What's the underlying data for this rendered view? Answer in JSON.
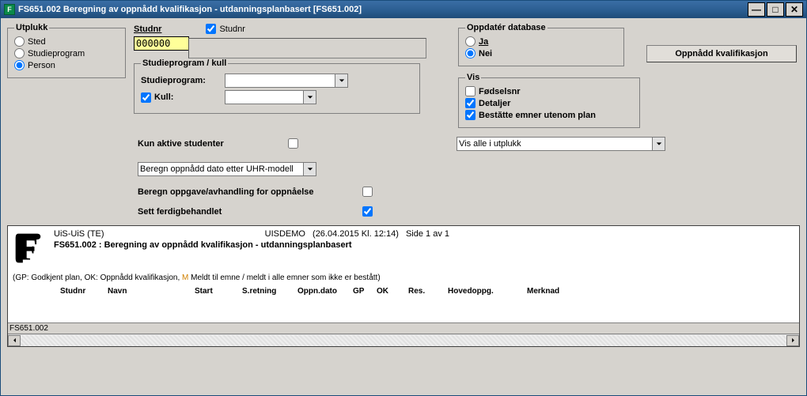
{
  "titlebar": {
    "icon_letter": "F",
    "title": "FS651.002 Beregning av oppnådd kvalifikasjon - utdanningsplanbasert [FS651.002]"
  },
  "utplukk": {
    "legend": "Utplukk",
    "options": {
      "sted": "Sted",
      "studieprogram": "Studieprogram",
      "person": "Person"
    },
    "selected": "person"
  },
  "studnr": {
    "label": "Studnr",
    "check_label": "Studnr",
    "value": "000000"
  },
  "sp_kull": {
    "legend": "Studieprogram / kull",
    "sp_label": "Studieprogram:",
    "kull_label": "Kull:",
    "sp_value": "",
    "kull_value": ""
  },
  "oppdater": {
    "legend": "Oppdatér database",
    "ja": "Ja",
    "nei": "Nei",
    "selected": "nei"
  },
  "vis": {
    "legend": "Vis",
    "fodselsnr": "Fødselsnr",
    "detaljer": "Detaljer",
    "bestatte": "Bestătte emner utenom plan",
    "fodselsnr_checked": false,
    "detaljer_checked": true,
    "bestatte_checked": true
  },
  "button": {
    "oppnadd": "Oppnådd kvalifikasjon"
  },
  "kun_aktive": {
    "label": "Kun aktive studenter",
    "checked": false
  },
  "vis_alle": {
    "value": "Vis alle i utplukk"
  },
  "calc_model": {
    "value": "Beregn oppnådd dato etter UHR-modell"
  },
  "beregn_oppg": {
    "label": "Beregn oppgave/avhandling for oppnåelse",
    "checked": false
  },
  "sett_ferdig": {
    "label": "Sett ferdigbehandlet",
    "checked": true
  },
  "report": {
    "org": "UiS-UiS  (TE)",
    "env": "UISDEMO",
    "datetime": "(26.04.2015 Kl. 12:14)",
    "page": "Side 1 av 1",
    "title": "FS651.002 : Beregning av oppnådd kvalifikasjon - utdanningsplanbasert",
    "legend_pre": "(GP: Godkjent plan, OK: Oppnådd kvalifikasjon, ",
    "legend_m": "M",
    "legend_post": " Meldt til emne / meldt i alle emner som ikke er bestått)",
    "columns": [
      "Studnr",
      "Navn",
      "Start",
      "S.retning",
      "Oppn.dato",
      "GP",
      "OK",
      "Res.",
      "Hovedoppg.",
      "Merknad"
    ]
  },
  "status": "FS651.002"
}
